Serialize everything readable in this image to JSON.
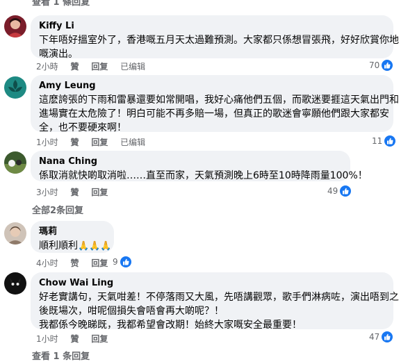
{
  "top_replies_link": "查看 1 條回复",
  "comments": [
    {
      "name": "Kiffy Li",
      "lines": [
        "下年唔好搵室外了，香港嘅五月天太過難預測。大家都只係想冒張飛，好好欣賞你地",
        "嘅演出。"
      ],
      "time": "2小時",
      "like": "贊",
      "reply": "回复",
      "edited": "已编辑",
      "reactions": "70",
      "avatar_color": "#7a1d2a"
    },
    {
      "name": "Amy Leung",
      "lines": [
        "這麽誇張的下雨和雷暴還要如常開唱，我好心痛他們五個，而歌迷要捱這天氣出門和",
        "進場實在太危險了！明白可能不再多賠一場，但真正的歌迷會寧願他們跟大家都安",
        "全，也不要硬來啊！"
      ],
      "time": "1小时",
      "like": "贊",
      "reply": "回复",
      "edited": "已编辑",
      "reactions": "11",
      "avatar_color": "#1e8a83"
    },
    {
      "name": "Nana Ching",
      "lines": [
        "係取消就快啲取消啦……直至而家，天氣預測晚上6時至10時降雨量100%！"
      ],
      "time": "3小时",
      "like": "贊",
      "reply": "回复",
      "reactions": "49",
      "avatar_color": "#3c5a2e"
    },
    {
      "name": "瑪莉",
      "lines": [
        "順利順利"
      ],
      "emoji": "🙏🙏🙏",
      "time": "4小时",
      "like": "赞",
      "reply": "回复",
      "reactions": "9",
      "avatar_color": "#b9a596"
    },
    {
      "name": "Chow Wai Ling",
      "lines": [
        "好老實講句，天氣咁差！不停落雨又大風，先唔講觀眾，歌手們淋病咗，演出唔到之",
        "後既場次，咁呢個損失會唔會再大啲呢？！",
        "我都係今晚睇既，我都希望會改期！始終大家嘅安全最重要！"
      ],
      "time": "1小时",
      "like": "贊",
      "reply": "回复",
      "reactions": "47",
      "avatar_color": "#111111"
    }
  ],
  "all_replies_link": "全部2条回复",
  "bottom_replies_link": "查看 1 条回复",
  "accent_color": "#1877f2"
}
